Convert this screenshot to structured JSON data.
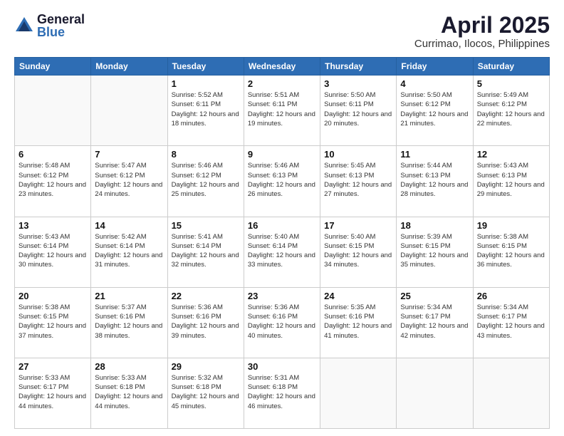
{
  "logo": {
    "general": "General",
    "blue": "Blue"
  },
  "title": "April 2025",
  "location": "Currimao, Ilocos, Philippines",
  "days_of_week": [
    "Sunday",
    "Monday",
    "Tuesday",
    "Wednesday",
    "Thursday",
    "Friday",
    "Saturday"
  ],
  "weeks": [
    [
      {
        "day": "",
        "info": ""
      },
      {
        "day": "",
        "info": ""
      },
      {
        "day": "1",
        "sunrise": "5:52 AM",
        "sunset": "6:11 PM",
        "daylight": "12 hours and 18 minutes."
      },
      {
        "day": "2",
        "sunrise": "5:51 AM",
        "sunset": "6:11 PM",
        "daylight": "12 hours and 19 minutes."
      },
      {
        "day": "3",
        "sunrise": "5:50 AM",
        "sunset": "6:11 PM",
        "daylight": "12 hours and 20 minutes."
      },
      {
        "day": "4",
        "sunrise": "5:50 AM",
        "sunset": "6:12 PM",
        "daylight": "12 hours and 21 minutes."
      },
      {
        "day": "5",
        "sunrise": "5:49 AM",
        "sunset": "6:12 PM",
        "daylight": "12 hours and 22 minutes."
      }
    ],
    [
      {
        "day": "6",
        "sunrise": "5:48 AM",
        "sunset": "6:12 PM",
        "daylight": "12 hours and 23 minutes."
      },
      {
        "day": "7",
        "sunrise": "5:47 AM",
        "sunset": "6:12 PM",
        "daylight": "12 hours and 24 minutes."
      },
      {
        "day": "8",
        "sunrise": "5:46 AM",
        "sunset": "6:12 PM",
        "daylight": "12 hours and 25 minutes."
      },
      {
        "day": "9",
        "sunrise": "5:46 AM",
        "sunset": "6:13 PM",
        "daylight": "12 hours and 26 minutes."
      },
      {
        "day": "10",
        "sunrise": "5:45 AM",
        "sunset": "6:13 PM",
        "daylight": "12 hours and 27 minutes."
      },
      {
        "day": "11",
        "sunrise": "5:44 AM",
        "sunset": "6:13 PM",
        "daylight": "12 hours and 28 minutes."
      },
      {
        "day": "12",
        "sunrise": "5:43 AM",
        "sunset": "6:13 PM",
        "daylight": "12 hours and 29 minutes."
      }
    ],
    [
      {
        "day": "13",
        "sunrise": "5:43 AM",
        "sunset": "6:14 PM",
        "daylight": "12 hours and 30 minutes."
      },
      {
        "day": "14",
        "sunrise": "5:42 AM",
        "sunset": "6:14 PM",
        "daylight": "12 hours and 31 minutes."
      },
      {
        "day": "15",
        "sunrise": "5:41 AM",
        "sunset": "6:14 PM",
        "daylight": "12 hours and 32 minutes."
      },
      {
        "day": "16",
        "sunrise": "5:40 AM",
        "sunset": "6:14 PM",
        "daylight": "12 hours and 33 minutes."
      },
      {
        "day": "17",
        "sunrise": "5:40 AM",
        "sunset": "6:15 PM",
        "daylight": "12 hours and 34 minutes."
      },
      {
        "day": "18",
        "sunrise": "5:39 AM",
        "sunset": "6:15 PM",
        "daylight": "12 hours and 35 minutes."
      },
      {
        "day": "19",
        "sunrise": "5:38 AM",
        "sunset": "6:15 PM",
        "daylight": "12 hours and 36 minutes."
      }
    ],
    [
      {
        "day": "20",
        "sunrise": "5:38 AM",
        "sunset": "6:15 PM",
        "daylight": "12 hours and 37 minutes."
      },
      {
        "day": "21",
        "sunrise": "5:37 AM",
        "sunset": "6:16 PM",
        "daylight": "12 hours and 38 minutes."
      },
      {
        "day": "22",
        "sunrise": "5:36 AM",
        "sunset": "6:16 PM",
        "daylight": "12 hours and 39 minutes."
      },
      {
        "day": "23",
        "sunrise": "5:36 AM",
        "sunset": "6:16 PM",
        "daylight": "12 hours and 40 minutes."
      },
      {
        "day": "24",
        "sunrise": "5:35 AM",
        "sunset": "6:16 PM",
        "daylight": "12 hours and 41 minutes."
      },
      {
        "day": "25",
        "sunrise": "5:34 AM",
        "sunset": "6:17 PM",
        "daylight": "12 hours and 42 minutes."
      },
      {
        "day": "26",
        "sunrise": "5:34 AM",
        "sunset": "6:17 PM",
        "daylight": "12 hours and 43 minutes."
      }
    ],
    [
      {
        "day": "27",
        "sunrise": "5:33 AM",
        "sunset": "6:17 PM",
        "daylight": "12 hours and 44 minutes."
      },
      {
        "day": "28",
        "sunrise": "5:33 AM",
        "sunset": "6:18 PM",
        "daylight": "12 hours and 44 minutes."
      },
      {
        "day": "29",
        "sunrise": "5:32 AM",
        "sunset": "6:18 PM",
        "daylight": "12 hours and 45 minutes."
      },
      {
        "day": "30",
        "sunrise": "5:31 AM",
        "sunset": "6:18 PM",
        "daylight": "12 hours and 46 minutes."
      },
      {
        "day": "",
        "info": ""
      },
      {
        "day": "",
        "info": ""
      },
      {
        "day": "",
        "info": ""
      }
    ]
  ]
}
